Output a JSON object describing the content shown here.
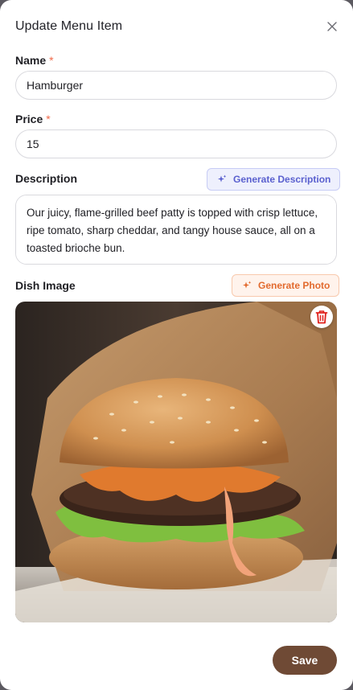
{
  "dialog": {
    "title": "Update Menu Item"
  },
  "fields": {
    "name": {
      "label": "Name",
      "required_mark": "*",
      "value": "Hamburger"
    },
    "price": {
      "label": "Price",
      "required_mark": "*",
      "value": "15"
    },
    "description": {
      "label": "Description",
      "value": "Our juicy, flame-grilled beef patty is topped with crisp lettuce, ripe tomato, sharp cheddar, and tangy house sauce, all on a toasted brioche bun.",
      "generate_label": "Generate Description"
    },
    "dish_image": {
      "label": "Dish Image",
      "generate_label": "Generate Photo"
    }
  },
  "actions": {
    "save_label": "Save"
  },
  "colors": {
    "save": "#6f4a35",
    "required": "#f06a4a",
    "generate_description": "#5a60cf",
    "generate_photo": "#e26a2e",
    "delete": "#e0201b"
  },
  "icons": {
    "close": "close-icon",
    "sparkle": "sparkle-icon",
    "delete": "trash-icon"
  }
}
